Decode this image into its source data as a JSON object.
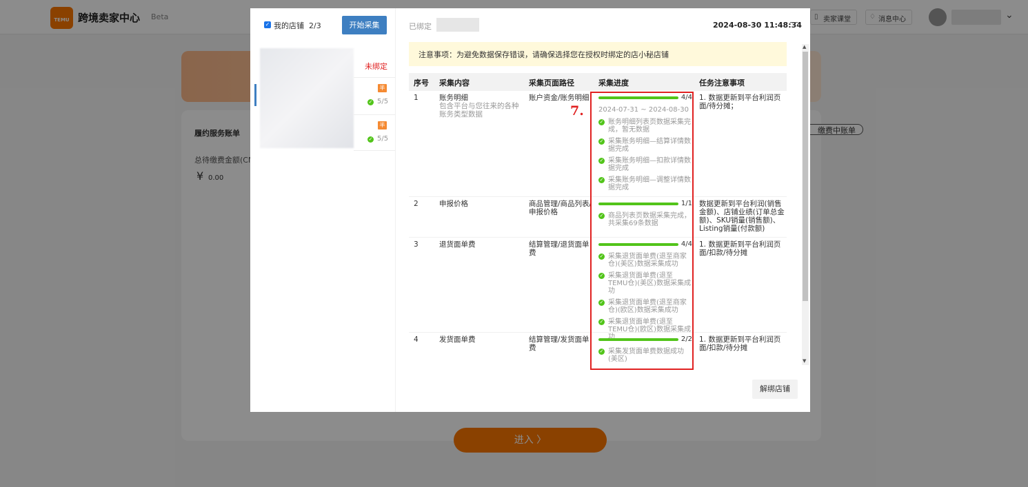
{
  "background": {
    "app_title": "跨境卖家中心",
    "beta": "Beta",
    "logo_text": "TEMU",
    "header_buttons": [
      "卖家课堂",
      "消息中心"
    ],
    "card_title": "履约服务账单",
    "card_button": "缴费中账单",
    "total_label": "总待缴费金额(CN",
    "currency": "¥",
    "amount": "0.00",
    "enter_label": "进入 〉"
  },
  "modal": {
    "sidebar": {
      "my_store_label": "我的店铺",
      "store_count": "2/3",
      "start_button": "开始采集",
      "unbound_label": "未绑定",
      "stores": [
        {
          "badge": "半",
          "count": "5/5"
        },
        {
          "badge": "半",
          "count": "5/5"
        }
      ]
    },
    "bound_label": "已绑定",
    "timestamp": "2024-08-30 11:48:34",
    "minimize": "—",
    "notice": "注意事项：为避免数据保存错误，请确保选择您在授权时绑定的店小秘店铺",
    "table": {
      "headers": [
        "序号",
        "采集内容",
        "采集页面路径",
        "采集进度",
        "任务注意事项"
      ],
      "rows": [
        {
          "no": "1",
          "content": "账务明细",
          "content_sub": "包含平台与您往来的各种账务类型数据",
          "path": "账户资金/账务明细",
          "progress": {
            "done": 4,
            "total": 4,
            "label": "4/4"
          },
          "dates": "2024-07-31 ~ 2024-08-30",
          "steps": [
            "账务明细列表页数据采集完成，暂无数据",
            "采集账务明细—结算详情数据完成",
            "采集账务明细—扣款详情数据完成",
            "采集账务明细—调整详情数据完成"
          ],
          "note": "1. 数据更新到平台利润页面/待分摊；"
        },
        {
          "no": "2",
          "content": "申报价格",
          "content_sub": "",
          "path": "商品管理/商品列表/申报价格",
          "progress": {
            "done": 1,
            "total": 1,
            "label": "1/1"
          },
          "dates": "",
          "steps": [
            "商品列表页数据采集完成，共采集69条数据"
          ],
          "note": "数据更新到平台利润(销售金额)、店铺业绩(订单总金额)、SKU销量(销售额)、Listing销量(付款额)"
        },
        {
          "no": "3",
          "content": "退货面单费",
          "content_sub": "",
          "path": "结算管理/退货面单费",
          "progress": {
            "done": 4,
            "total": 4,
            "label": "4/4"
          },
          "dates": "",
          "steps": [
            "采集退货面单费(退至商家仓)(美区)数据采集成功",
            "采集退货面单费(退至TEMU仓)(美区)数据采集成功",
            "采集退货面单费(退至商家仓)(欧区)数据采集成功",
            "采集退货面单费(退至TEMU仓)(欧区)数据采集成功"
          ],
          "note": "1. 数据更新到平台利润页面/扣款/待分摊"
        },
        {
          "no": "4",
          "content": "发货面单费",
          "content_sub": "",
          "path": "结算管理/发货面单费",
          "progress": {
            "done": 2,
            "total": 2,
            "label": "2/2"
          },
          "dates": "",
          "steps": [
            "采集发货面单费数据成功(美区)"
          ],
          "note": "1. 数据更新到平台利润页面/扣款/待分摊"
        }
      ]
    },
    "annotation": "7.",
    "unbind_button": "解绑店铺",
    "colors": {
      "accent": "#3e7fc1",
      "success": "#52c41a",
      "highlight": "#e02020",
      "brand": "#fb7701"
    }
  }
}
